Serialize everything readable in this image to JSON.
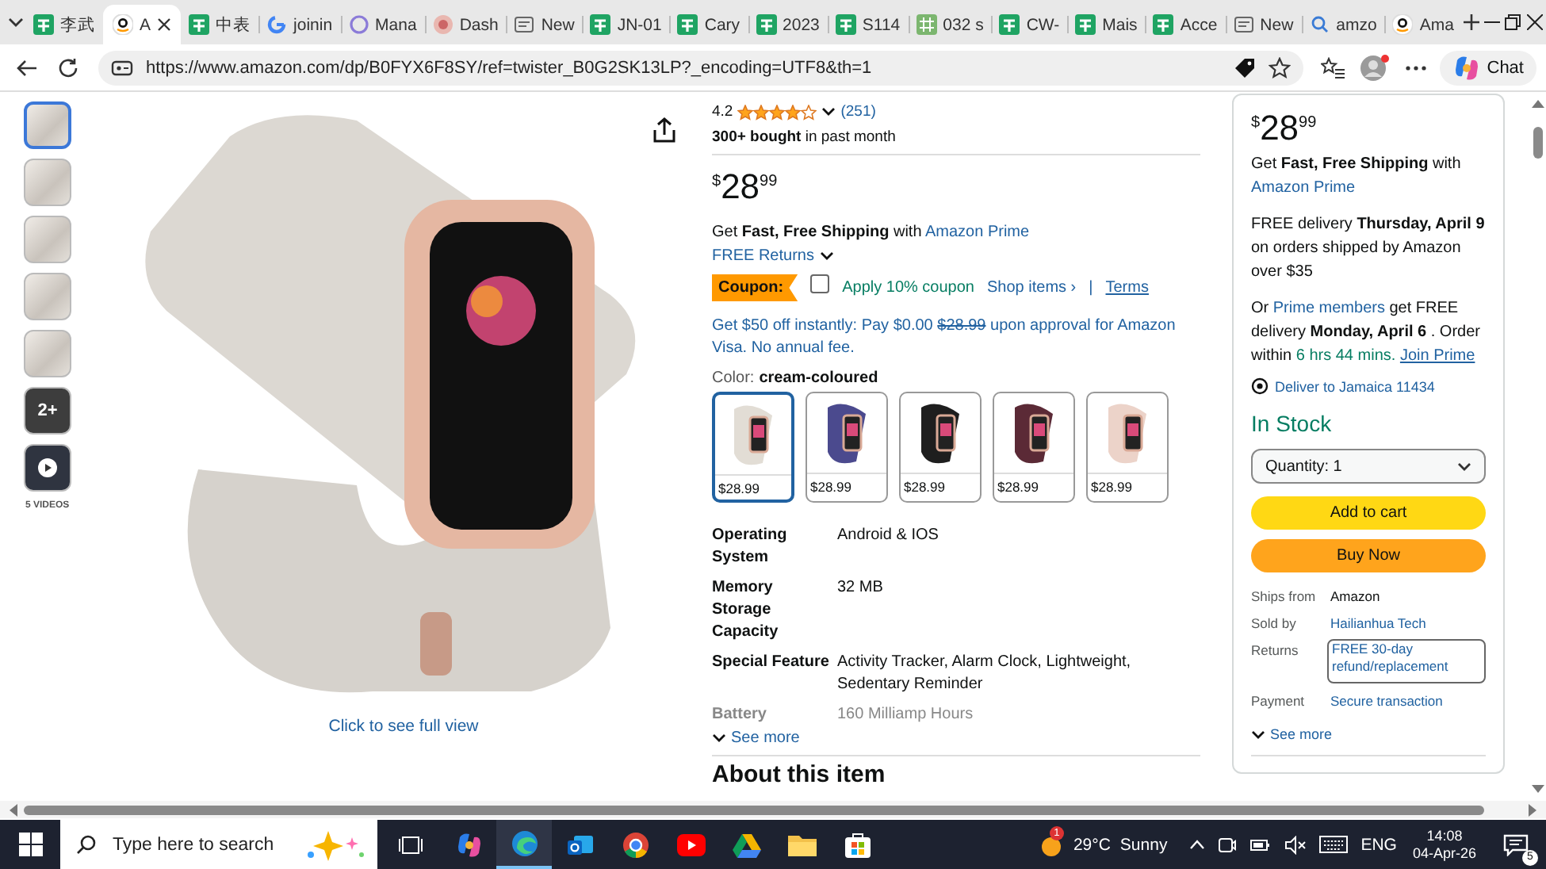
{
  "browser": {
    "tabs": [
      {
        "title": "李武",
        "kind": "sheet",
        "selected": false
      },
      {
        "title": "A",
        "kind": "amazon",
        "selected": true
      },
      {
        "title": "中表",
        "kind": "sheet",
        "selected": false
      },
      {
        "title": "joinin",
        "kind": "google",
        "selected": false
      },
      {
        "title": "Mana",
        "kind": "circle",
        "selected": false
      },
      {
        "title": "Dash",
        "kind": "dash",
        "selected": false
      },
      {
        "title": "New",
        "kind": "page",
        "selected": false
      },
      {
        "title": "JN-01",
        "kind": "sheet",
        "selected": false
      },
      {
        "title": "Cary",
        "kind": "sheet",
        "selected": false
      },
      {
        "title": "2023",
        "kind": "sheet",
        "selected": false
      },
      {
        "title": "S114",
        "kind": "sheet",
        "selected": false
      },
      {
        "title": "032 s",
        "kind": "grid",
        "selected": false
      },
      {
        "title": "CW-",
        "kind": "sheet",
        "selected": false
      },
      {
        "title": "Mais",
        "kind": "sheet",
        "selected": false
      },
      {
        "title": "Acce",
        "kind": "sheet",
        "selected": false
      },
      {
        "title": "New",
        "kind": "page",
        "selected": false
      },
      {
        "title": "amzo",
        "kind": "search",
        "selected": false
      },
      {
        "title": "Ama",
        "kind": "amazon",
        "selected": false
      }
    ],
    "url": "https://www.amazon.com/dp/B0FYX6F8SY/ref=twister_B0G2SK13LP?_encoding=UTF8&th=1",
    "chat_label": "Chat"
  },
  "product": {
    "thumbnails": [
      {
        "kind": "image",
        "selected": true
      },
      {
        "kind": "image",
        "selected": false
      },
      {
        "kind": "image",
        "selected": false
      },
      {
        "kind": "image",
        "selected": false
      },
      {
        "kind": "image",
        "selected": false
      },
      {
        "kind": "more",
        "label": "2+",
        "selected": false
      },
      {
        "kind": "video",
        "selected": false
      }
    ],
    "videos_label": "5 VIDEOS",
    "image_link": "Click to see full view",
    "rating": {
      "value": "4.2",
      "stars": 4,
      "count": "(251)"
    },
    "bought": "**300+ bought** in past month",
    "price": {
      "currency": "$",
      "whole": "28",
      "fraction": "99"
    },
    "shipping": {
      "text": "Get **Fast, Free Shipping** with",
      "link": "Amazon Prime"
    },
    "returns": "FREE Returns",
    "coupon": {
      "badge": "Coupon:",
      "checked": false,
      "text": "Apply 10% coupon",
      "shop": "Shop items ›",
      "separator": "|",
      "terms": "Terms"
    },
    "offer": {
      "before": "Get $50 off instantly: Pay $0.00",
      "struck": "$28.99",
      "after": "upon approval for Amazon Visa. No annual fee."
    },
    "variant": {
      "label": "Color:",
      "value": "cream-coloured"
    },
    "swatches": [
      {
        "price": "$28.99",
        "color": "#e2ddd5",
        "selected": true
      },
      {
        "price": "$28.99",
        "color": "#4b4a8e",
        "selected": false
      },
      {
        "price": "$28.99",
        "color": "#1e1e1e",
        "selected": false
      },
      {
        "price": "$28.99",
        "color": "#5b2a36",
        "selected": false
      },
      {
        "price": "$28.99",
        "color": "#ecd3c9",
        "selected": false
      }
    ],
    "specs": [
      {
        "label": "Operating System",
        "value": "Android & IOS"
      },
      {
        "label": "Memory Storage Capacity",
        "value": "32 MB"
      },
      {
        "label": "Special Feature",
        "value": "Activity Tracker, Alarm Clock, Lightweight, Sedentary Reminder"
      },
      {
        "label": "Battery",
        "value": "160 Milliamp Hours"
      }
    ],
    "see_more": "See more",
    "about_heading": "About this item"
  },
  "buy_box": {
    "price": {
      "currency": "$",
      "whole": "28",
      "fraction": "99"
    },
    "shipping": {
      "text": "Get **Fast, Free Shipping** with",
      "link": "Amazon Prime"
    },
    "delivery": "FREE delivery **Thursday, April 9** on orders shipped by Amazon over $35",
    "prime_delivery": [
      {
        "kind": "text",
        "text": "Or"
      },
      {
        "kind": "link",
        "text": "Prime members"
      },
      {
        "kind": "text",
        "text": "get FREE delivery"
      },
      {
        "kind": "bold",
        "text": "Monday, April 6"
      },
      {
        "kind": "text",
        "text": ". Order within"
      },
      {
        "kind": "timer",
        "text": "6 hrs 44 mins."
      },
      {
        "kind": "underlined_link",
        "text": "Join Prime"
      }
    ],
    "location": "Deliver to Jamaica 11434",
    "stock": "In Stock",
    "quantity": "Quantity: 1",
    "add_to_cart": "Add to cart",
    "buy_now": "Buy Now",
    "details": [
      {
        "label": "Ships from",
        "value": "Amazon",
        "kind": "text"
      },
      {
        "label": "Sold by",
        "value": "Hailianhua Tech",
        "kind": "link"
      },
      {
        "label": "Returns",
        "value": "FREE 30-day refund/replacement",
        "kind": "boxed_link"
      },
      {
        "label": "Payment",
        "value": "Secure transaction",
        "kind": "link"
      }
    ],
    "see_more": "See more"
  },
  "taskbar": {
    "search_placeholder": "Type here to search",
    "apps": [
      {
        "kind": "copilot",
        "selected": false
      },
      {
        "kind": "edge",
        "selected": true
      },
      {
        "kind": "outlook",
        "selected": false
      },
      {
        "kind": "chrome",
        "selected": false
      },
      {
        "kind": "youtube",
        "selected": false
      },
      {
        "kind": "drive",
        "selected": false
      },
      {
        "kind": "folder",
        "selected": false
      },
      {
        "kind": "store",
        "selected": false
      }
    ],
    "weather": {
      "badge": "1",
      "temp": "29°C",
      "condition": "Sunny"
    },
    "language": "ENG",
    "time": "14:08",
    "date": "04-Apr-26",
    "notifications": "5"
  }
}
